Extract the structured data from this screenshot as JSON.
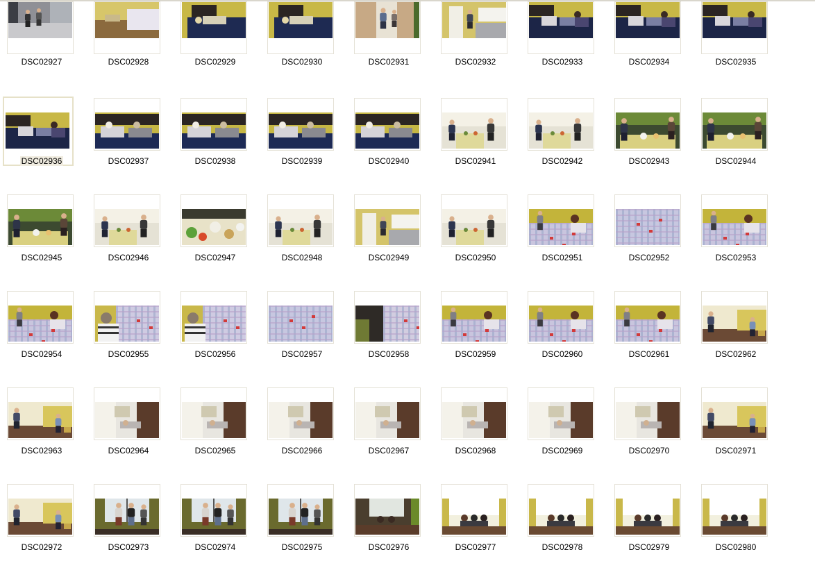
{
  "window": {
    "view": "thumbnails"
  },
  "colors": {
    "frame_border": "#e4e1d6",
    "selected_border": "#e6e1c8",
    "selected_label_bg": "#f0ece0"
  },
  "selected_index": 9,
  "files": [
    {
      "name": "DSC02927",
      "scene": "street"
    },
    {
      "name": "DSC02928",
      "scene": "room-desk"
    },
    {
      "name": "DSC02929",
      "scene": "bed-person"
    },
    {
      "name": "DSC02930",
      "scene": "bed-person"
    },
    {
      "name": "DSC02931",
      "scene": "doorway"
    },
    {
      "name": "DSC02932",
      "scene": "kitchen"
    },
    {
      "name": "DSC02933",
      "scene": "bed-group"
    },
    {
      "name": "DSC02934",
      "scene": "bed-group"
    },
    {
      "name": "DSC02935",
      "scene": "bed-group"
    },
    {
      "name": "DSC02936",
      "scene": "bed-group"
    },
    {
      "name": "DSC02937",
      "scene": "bed-two"
    },
    {
      "name": "DSC02938",
      "scene": "bed-two"
    },
    {
      "name": "DSC02939",
      "scene": "bed-two"
    },
    {
      "name": "DSC02940",
      "scene": "bed-two"
    },
    {
      "name": "DSC02941",
      "scene": "table-group"
    },
    {
      "name": "DSC02942",
      "scene": "table-group"
    },
    {
      "name": "DSC02943",
      "scene": "table-food"
    },
    {
      "name": "DSC02944",
      "scene": "table-food"
    },
    {
      "name": "DSC02945",
      "scene": "table-food"
    },
    {
      "name": "DSC02946",
      "scene": "table-group"
    },
    {
      "name": "DSC02947",
      "scene": "food-closeup"
    },
    {
      "name": "DSC02948",
      "scene": "table-group"
    },
    {
      "name": "DSC02949",
      "scene": "kitchen"
    },
    {
      "name": "DSC02950",
      "scene": "table-group"
    },
    {
      "name": "DSC02951",
      "scene": "plaid-bed"
    },
    {
      "name": "DSC02952",
      "scene": "plaid"
    },
    {
      "name": "DSC02953",
      "scene": "plaid-bed"
    },
    {
      "name": "DSC02954",
      "scene": "plaid-bed"
    },
    {
      "name": "DSC02955",
      "scene": "plaid-person"
    },
    {
      "name": "DSC02956",
      "scene": "plaid-person"
    },
    {
      "name": "DSC02957",
      "scene": "plaid"
    },
    {
      "name": "DSC02958",
      "scene": "plaid-dark"
    },
    {
      "name": "DSC02959",
      "scene": "plaid-bed"
    },
    {
      "name": "DSC02960",
      "scene": "plaid-bed"
    },
    {
      "name": "DSC02961",
      "scene": "plaid-bed"
    },
    {
      "name": "DSC02962",
      "scene": "room-floor"
    },
    {
      "name": "DSC02963",
      "scene": "room-floor"
    },
    {
      "name": "DSC02964",
      "scene": "rotated"
    },
    {
      "name": "DSC02965",
      "scene": "rotated"
    },
    {
      "name": "DSC02966",
      "scene": "rotated"
    },
    {
      "name": "DSC02967",
      "scene": "rotated"
    },
    {
      "name": "DSC02968",
      "scene": "rotated"
    },
    {
      "name": "DSC02969",
      "scene": "rotated"
    },
    {
      "name": "DSC02970",
      "scene": "rotated"
    },
    {
      "name": "DSC02971",
      "scene": "room-floor"
    },
    {
      "name": "DSC02972",
      "scene": "room-floor"
    },
    {
      "name": "DSC02973",
      "scene": "window-group"
    },
    {
      "name": "DSC02974",
      "scene": "window-group"
    },
    {
      "name": "DSC02975",
      "scene": "window-group"
    },
    {
      "name": "DSC02976",
      "scene": "window-dark"
    },
    {
      "name": "DSC02977",
      "scene": "window-bright"
    },
    {
      "name": "DSC02978",
      "scene": "window-bright"
    },
    {
      "name": "DSC02979",
      "scene": "window-bright"
    },
    {
      "name": "DSC02980",
      "scene": "window-bright"
    }
  ]
}
